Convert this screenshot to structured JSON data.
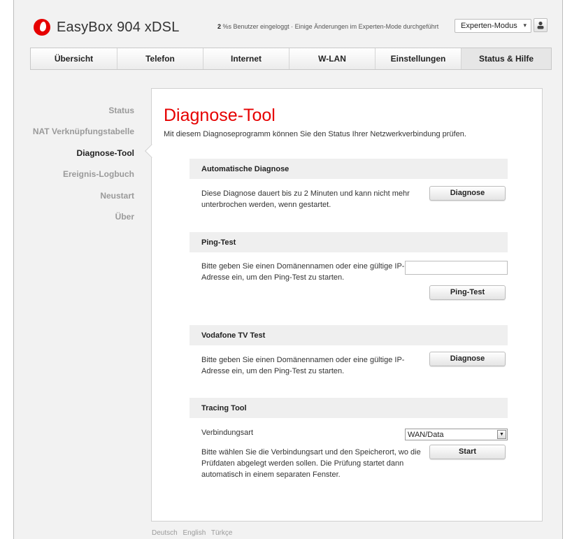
{
  "header": {
    "app_title": "EasyBox 904 xDSL",
    "login_info_bold": "2",
    "login_info": " %s Benutzer eingeloggt · Einige Änderungen im Experten-Mode durchgeführt",
    "mode_select": "Experten-Modus",
    "mode_caret": "▾",
    "brand_color": "#e60000"
  },
  "nav": {
    "tabs": [
      {
        "label": "Übersicht"
      },
      {
        "label": "Telefon"
      },
      {
        "label": "Internet"
      },
      {
        "label": "W-LAN"
      },
      {
        "label": "Einstellungen"
      },
      {
        "label": "Status & Hilfe"
      }
    ],
    "active": "Status & Hilfe"
  },
  "sidebar": {
    "items": [
      {
        "label": "Status"
      },
      {
        "label": "NAT Verknüpfungstabelle"
      },
      {
        "label": "Diagnose-Tool"
      },
      {
        "label": "Ereignis-Logbuch"
      },
      {
        "label": "Neustart"
      },
      {
        "label": "Über"
      }
    ],
    "active": "Diagnose-Tool"
  },
  "main": {
    "title": "Diagnose-Tool",
    "subtitle": "Mit diesem Diagnoseprogramm können Sie den Status Ihrer Netzwerkverbindung prüfen.",
    "auto": {
      "heading": "Automatische Diagnose",
      "text_line1": "Diese Diagnose dauert bis zu 2 Minuten und kann nicht mehr",
      "text_line2": "unterbrochen werden, wenn gestartet.",
      "button": "Diagnose"
    },
    "ping": {
      "heading": "Ping-Test",
      "text_line1": "Bitte geben Sie einen Domänennamen oder eine gültige IP-",
      "text_line2": "Adresse ein, um den Ping-Test zu starten.",
      "input_value": "",
      "button": "Ping-Test"
    },
    "tv": {
      "heading": "Vodafone TV Test",
      "text_line1": "Bitte geben Sie einen Domänennamen oder eine gültige IP-",
      "text_line2": "Adresse ein, um den Ping-Test zu starten.",
      "button": "Diagnose"
    },
    "tracing": {
      "heading": "Tracing Tool",
      "type_label": "Verbindungsart",
      "type_value": "WAN/Data",
      "select_arrow": "▼",
      "text_line1": "Bitte wählen Sie die Verbindungsart und den Speicherort, wo die",
      "text_line2": "Prüfdaten abgelegt werden sollen. Die Prüfung startet dann",
      "text_line3": "automatisch in einem separaten Fenster.",
      "button": "Start"
    }
  },
  "footer": {
    "languages": [
      "Deutsch",
      "English",
      "Türkçe"
    ]
  }
}
